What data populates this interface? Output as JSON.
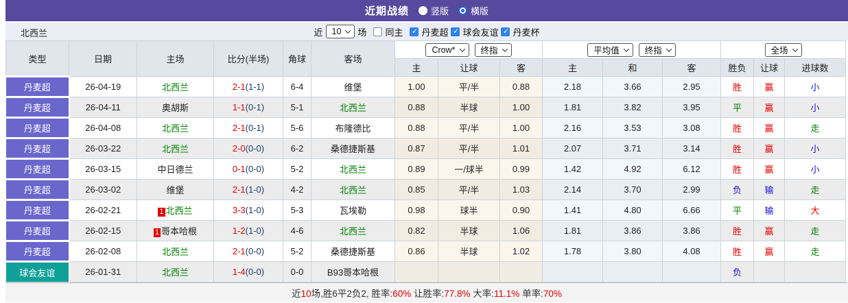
{
  "colors": {
    "red": "#E60000",
    "green": "#008000",
    "blue": "#1414D8",
    "navy": "#1A3C6E",
    "league_bg": "#6966CC",
    "friendly_bg": "#0FA099",
    "titlebar_bg": "#57499E",
    "checkbox_blue": "#2B83EA"
  },
  "titlebar": {
    "title": "近期战绩",
    "radio_vertical": "竖版",
    "radio_horizontal": "横版",
    "selected": "横版"
  },
  "controls": {
    "team": "北西兰",
    "recent_label": "近",
    "recent_value": "10",
    "matches_label": "场",
    "same_home": {
      "label": "同主",
      "checked": false
    },
    "filters": [
      {
        "label": "丹麦超",
        "checked": true
      },
      {
        "label": "球会友谊",
        "checked": true
      },
      {
        "label": "丹麦杯",
        "checked": true
      }
    ]
  },
  "table": {
    "headers": {
      "type": "类型",
      "date": "日期",
      "home": "主场",
      "score": "比分(半场)",
      "corner": "角球",
      "away": "客场",
      "ah_home": "主",
      "ah_line": "让球",
      "ah_away": "客",
      "eu_home": "主",
      "eu_draw": "和",
      "eu_away": "客",
      "result": "胜负",
      "handicap": "让球",
      "goals": "进球数"
    },
    "dropdowns": {
      "ah_source": "Crow*",
      "ah_time": "终指",
      "eu_source": "平均值",
      "eu_time": "终指",
      "scope": "全场"
    },
    "rows": [
      {
        "type": "丹麦超",
        "type_style": "league",
        "date": "26-04-19",
        "home": "北西兰",
        "home_green": true,
        "home_rank": "",
        "score": "2-1",
        "half": "(1-1)",
        "corner": "6-4",
        "away": "维堡",
        "away_green": false,
        "ah_home": "1.00",
        "ah_line": "平/半",
        "ah_away": "0.88",
        "eu_home": "2.18",
        "eu_draw": "3.66",
        "eu_away": "2.95",
        "result": "胜",
        "result_color": "red",
        "handicap": "赢",
        "handicap_color": "red",
        "goals": "小",
        "goals_color": "blue"
      },
      {
        "type": "丹麦超",
        "type_style": "league",
        "date": "26-04-11",
        "home": "奥胡斯",
        "home_green": false,
        "home_rank": "",
        "score": "1-1",
        "half": "(0-1)",
        "corner": "5-1",
        "away": "北西兰",
        "away_green": true,
        "ah_home": "0.88",
        "ah_line": "半球",
        "ah_away": "1.00",
        "eu_home": "1.81",
        "eu_draw": "3.82",
        "eu_away": "3.95",
        "result": "平",
        "result_color": "green",
        "handicap": "赢",
        "handicap_color": "red",
        "goals": "小",
        "goals_color": "blue"
      },
      {
        "type": "丹麦超",
        "type_style": "league",
        "date": "26-04-08",
        "home": "北西兰",
        "home_green": true,
        "home_rank": "",
        "score": "2-1",
        "half": "(0-1)",
        "corner": "5-6",
        "away": "布隆德比",
        "away_green": false,
        "ah_home": "0.88",
        "ah_line": "平/半",
        "ah_away": "1.00",
        "eu_home": "2.16",
        "eu_draw": "3.53",
        "eu_away": "3.08",
        "result": "胜",
        "result_color": "red",
        "handicap": "赢",
        "handicap_color": "red",
        "goals": "走",
        "goals_color": "green"
      },
      {
        "type": "丹麦超",
        "type_style": "league",
        "date": "26-03-22",
        "home": "北西兰",
        "home_green": true,
        "home_rank": "",
        "score": "2-0",
        "half": "(0-0)",
        "corner": "6-2",
        "away": "桑德捷斯基",
        "away_green": false,
        "ah_home": "0.87",
        "ah_line": "平/半",
        "ah_away": "1.01",
        "eu_home": "2.07",
        "eu_draw": "3.71",
        "eu_away": "3.14",
        "result": "胜",
        "result_color": "red",
        "handicap": "赢",
        "handicap_color": "red",
        "goals": "小",
        "goals_color": "blue"
      },
      {
        "type": "丹麦超",
        "type_style": "league",
        "date": "26-03-15",
        "home": "中日德兰",
        "home_green": false,
        "home_rank": "",
        "score": "0-1",
        "half": "(0-0)",
        "corner": "5-2",
        "away": "北西兰",
        "away_green": true,
        "ah_home": "0.89",
        "ah_line": "一/球半",
        "ah_away": "0.99",
        "eu_home": "1.42",
        "eu_draw": "4.92",
        "eu_away": "6.12",
        "result": "胜",
        "result_color": "red",
        "handicap": "赢",
        "handicap_color": "red",
        "goals": "小",
        "goals_color": "blue"
      },
      {
        "type": "丹麦超",
        "type_style": "league",
        "date": "26-03-02",
        "home": "维堡",
        "home_green": false,
        "home_rank": "",
        "score": "2-1",
        "half": "(1-0)",
        "corner": "4-2",
        "away": "北西兰",
        "away_green": true,
        "ah_home": "0.85",
        "ah_line": "平/半",
        "ah_away": "1.03",
        "eu_home": "2.14",
        "eu_draw": "3.70",
        "eu_away": "2.99",
        "result": "负",
        "result_color": "blue",
        "handicap": "输",
        "handicap_color": "blue",
        "goals": "走",
        "goals_color": "green"
      },
      {
        "type": "丹麦超",
        "type_style": "league",
        "date": "26-02-21",
        "home": "北西兰",
        "home_green": true,
        "home_rank": "1",
        "score": "3-3",
        "half": "(1-0)",
        "corner": "5-3",
        "away": "瓦埃勒",
        "away_green": false,
        "ah_home": "0.98",
        "ah_line": "球半",
        "ah_away": "0.90",
        "eu_home": "1.41",
        "eu_draw": "4.80",
        "eu_away": "6.66",
        "result": "平",
        "result_color": "green",
        "handicap": "输",
        "handicap_color": "blue",
        "goals": "大",
        "goals_color": "red"
      },
      {
        "type": "丹麦超",
        "type_style": "league",
        "date": "26-02-15",
        "home": "哥本哈根",
        "home_green": false,
        "home_rank": "1",
        "score": "1-2",
        "half": "(1-0)",
        "corner": "4-6",
        "away": "北西兰",
        "away_green": true,
        "ah_home": "0.82",
        "ah_line": "半球",
        "ah_away": "1.06",
        "eu_home": "1.81",
        "eu_draw": "3.86",
        "eu_away": "3.86",
        "result": "胜",
        "result_color": "red",
        "handicap": "赢",
        "handicap_color": "red",
        "goals": "走",
        "goals_color": "green"
      },
      {
        "type": "丹麦超",
        "type_style": "league",
        "date": "26-02-08",
        "home": "北西兰",
        "home_green": true,
        "home_rank": "",
        "score": "2-1",
        "half": "(0-0)",
        "corner": "5-2",
        "away": "桑德捷斯基",
        "away_green": false,
        "ah_home": "0.86",
        "ah_line": "半球",
        "ah_away": "1.02",
        "eu_home": "1.78",
        "eu_draw": "3.80",
        "eu_away": "4.08",
        "result": "胜",
        "result_color": "red",
        "handicap": "赢",
        "handicap_color": "red",
        "goals": "走",
        "goals_color": "green"
      },
      {
        "type": "球会友谊",
        "type_style": "friendly",
        "date": "26-01-31",
        "home": "北西兰",
        "home_green": true,
        "home_rank": "",
        "score": "1-4",
        "half": "(0-0)",
        "corner": "0-0",
        "away": "B93哥本哈根",
        "away_green": false,
        "ah_home": "",
        "ah_line": "",
        "ah_away": "",
        "eu_home": "",
        "eu_draw": "",
        "eu_away": "",
        "result": "负",
        "result_color": "blue",
        "handicap": "",
        "handicap_color": "",
        "goals": "",
        "goals_color": ""
      }
    ]
  },
  "footer": {
    "segments": [
      {
        "text": "近",
        "red": false
      },
      {
        "text": "10",
        "red": true
      },
      {
        "text": "场,胜6平2负2, 胜率:",
        "red": false
      },
      {
        "text": "60%",
        "red": true
      },
      {
        "text": " 让胜率:",
        "red": false
      },
      {
        "text": "77.8%",
        "red": true
      },
      {
        "text": " 大率:",
        "red": false
      },
      {
        "text": "11.1%",
        "red": true
      },
      {
        "text": " 单率:",
        "red": false
      },
      {
        "text": "70%",
        "red": true
      }
    ]
  }
}
